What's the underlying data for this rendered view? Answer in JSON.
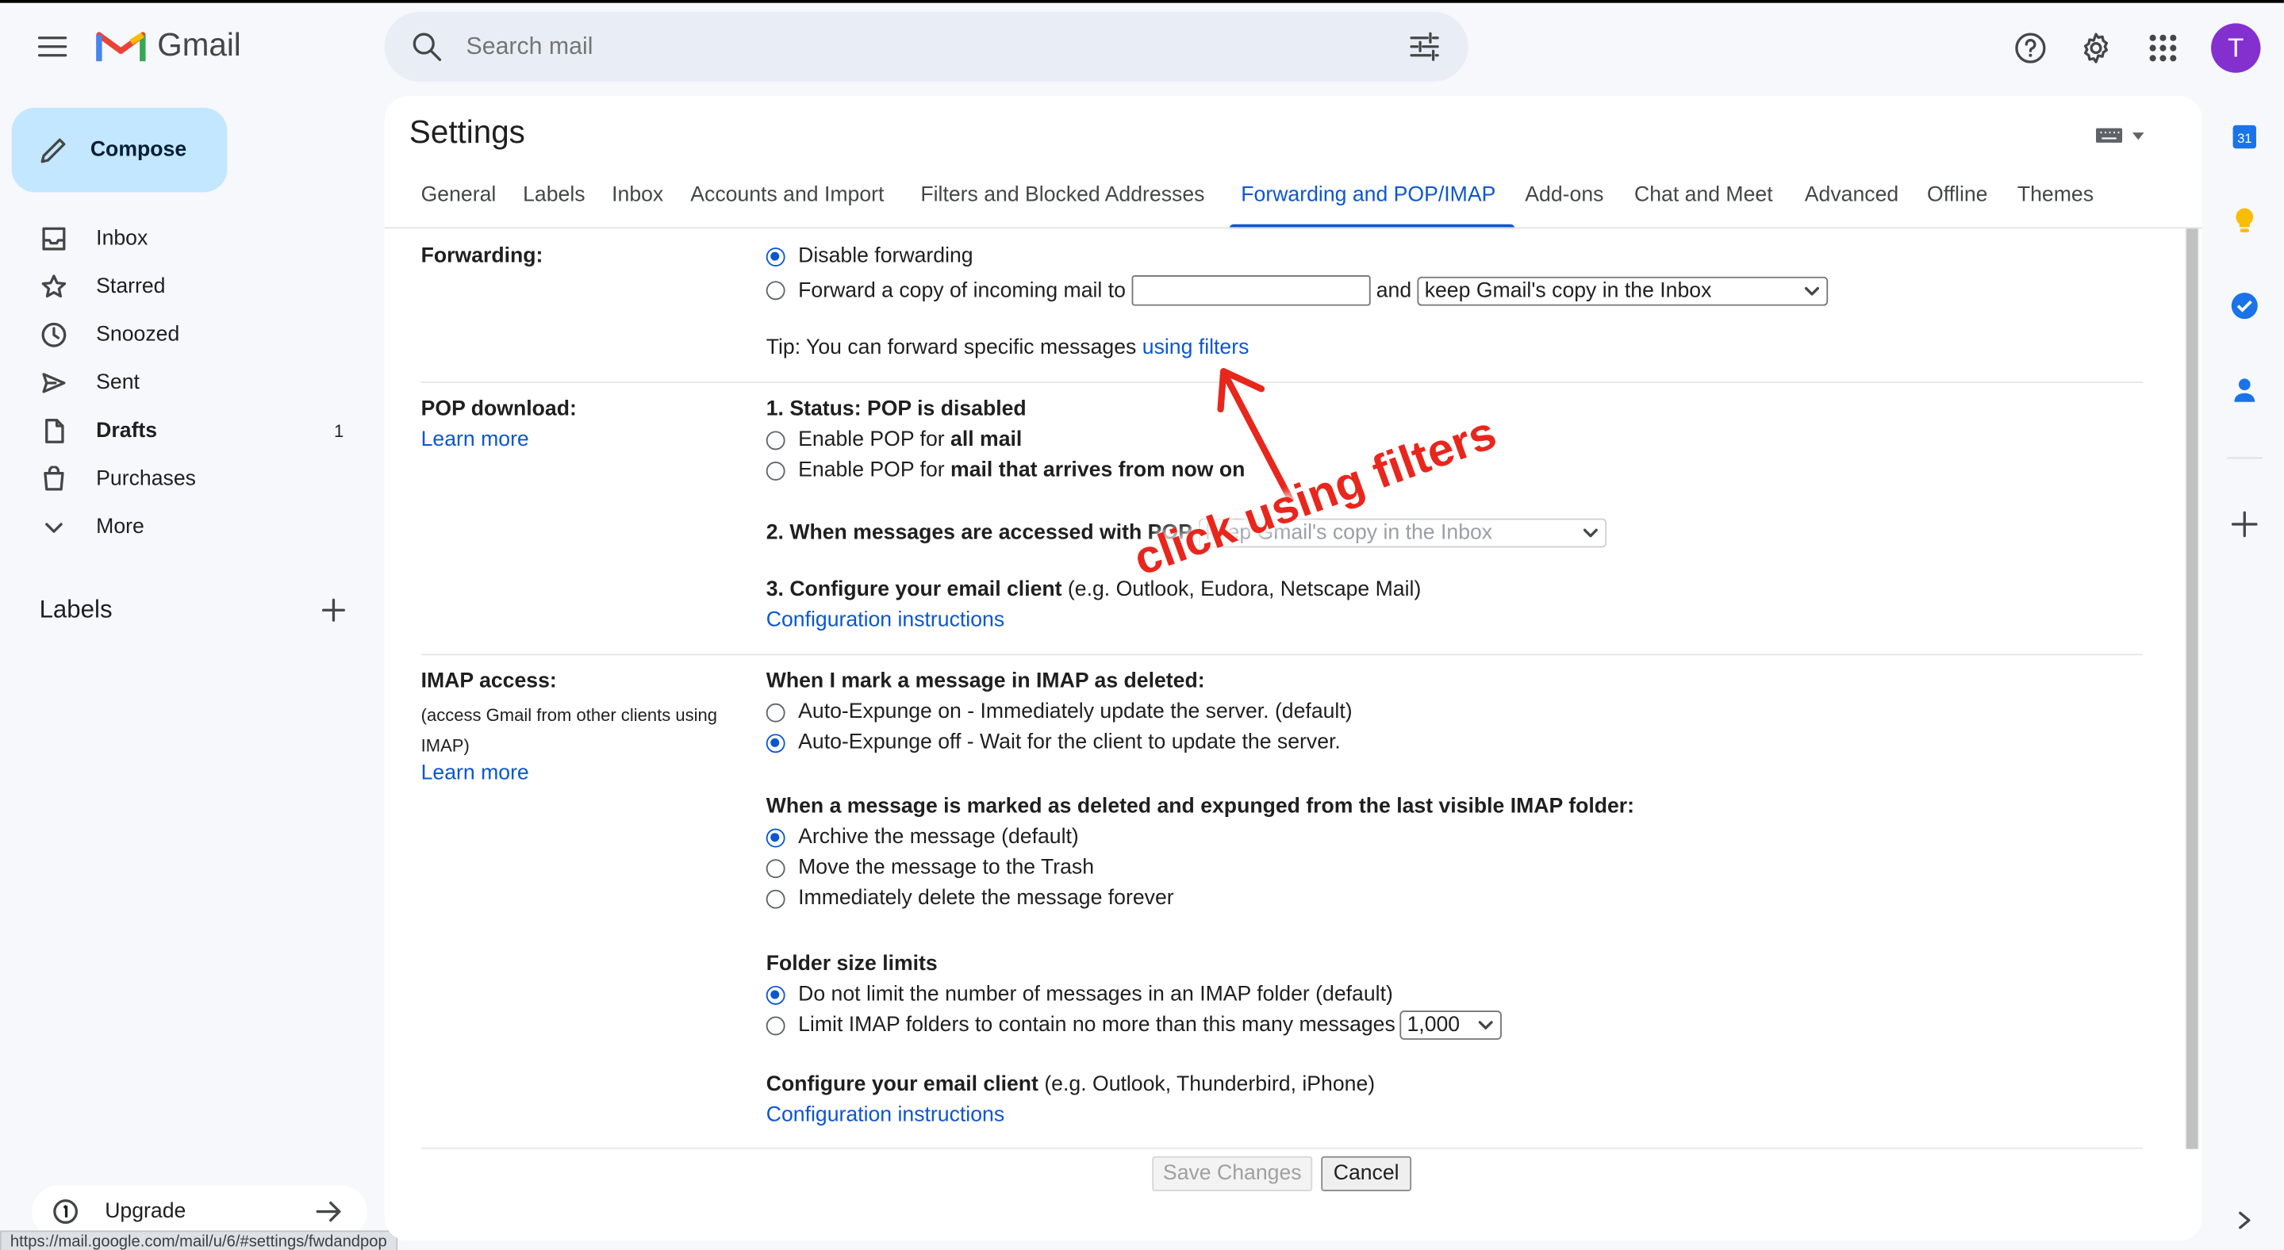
{
  "app": {
    "name": "Gmail"
  },
  "search": {
    "placeholder": "Search mail"
  },
  "avatar": {
    "initial": "T",
    "color": "#8430ce"
  },
  "compose": {
    "label": "Compose"
  },
  "nav": [
    {
      "label": "Inbox",
      "icon": "inbox-icon",
      "count": ""
    },
    {
      "label": "Starred",
      "icon": "star-icon",
      "count": ""
    },
    {
      "label": "Snoozed",
      "icon": "clock-icon",
      "count": ""
    },
    {
      "label": "Sent",
      "icon": "send-icon",
      "count": ""
    },
    {
      "label": "Drafts",
      "icon": "draft-icon",
      "count": "1"
    },
    {
      "label": "Purchases",
      "icon": "bag-icon",
      "count": ""
    },
    {
      "label": "More",
      "icon": "chevron-down-icon",
      "count": ""
    }
  ],
  "labels": {
    "title": "Labels"
  },
  "upgrade": {
    "label": "Upgrade"
  },
  "status_url": "https://mail.google.com/mail/u/6/#settings/fwdandpop",
  "settings": {
    "title": "Settings",
    "tabs": [
      "General",
      "Labels",
      "Inbox",
      "Accounts and Import",
      "Filters and Blocked Addresses",
      "Forwarding and POP/IMAP",
      "Add-ons",
      "Chat and Meet",
      "Advanced",
      "Offline",
      "Themes"
    ],
    "active_tab": "Forwarding and POP/IMAP",
    "forwarding": {
      "label": "Forwarding:",
      "opt_disable": "Disable forwarding",
      "opt_forward": "Forward a copy of incoming mail to",
      "and": "and",
      "keep_select": "keep Gmail's copy in the Inbox",
      "tip": "Tip: You can forward specific messages ",
      "tip_link": "using filters"
    },
    "pop": {
      "label": "POP download:",
      "learn_more": "Learn more",
      "status": "1. Status: POP is disabled",
      "opt_all_pre": "Enable POP for ",
      "opt_all_b": "all mail",
      "opt_now_pre": "Enable POP for ",
      "opt_now_b": "mail that arrives from now on",
      "when": "2. When messages are accessed with POP",
      "when_select": "keep Gmail's copy in the Inbox",
      "config_b": "3. Configure your email client",
      "config_rest": " (e.g. Outlook, Eudora, Netscape Mail)",
      "config_link": "Configuration instructions"
    },
    "imap": {
      "label": "IMAP access:",
      "sub": "(access Gmail from other clients using IMAP)",
      "learn_more": "Learn more",
      "mark_title": "When I mark a message in IMAP as deleted:",
      "auto_on": "Auto-Expunge on - Immediately update the server. (default)",
      "auto_off": "Auto-Expunge off - Wait for the client to update the server.",
      "expunge_title": "When a message is marked as deleted and expunged from the last visible IMAP folder:",
      "archive": "Archive the message (default)",
      "trash": "Move the message to the Trash",
      "delete": "Immediately delete the message forever",
      "folder_title": "Folder size limits",
      "no_limit": "Do not limit the number of messages in an IMAP folder (default)",
      "limit": "Limit IMAP folders to contain no more than this many messages",
      "limit_value": "1,000",
      "config_b": "Configure your email client",
      "config_rest": " (e.g. Outlook, Thunderbird, iPhone)",
      "config_link": "Configuration instructions"
    },
    "save": "Save Changes",
    "cancel": "Cancel"
  },
  "annotation": {
    "text": "click using filters",
    "color": "#e8261c"
  }
}
